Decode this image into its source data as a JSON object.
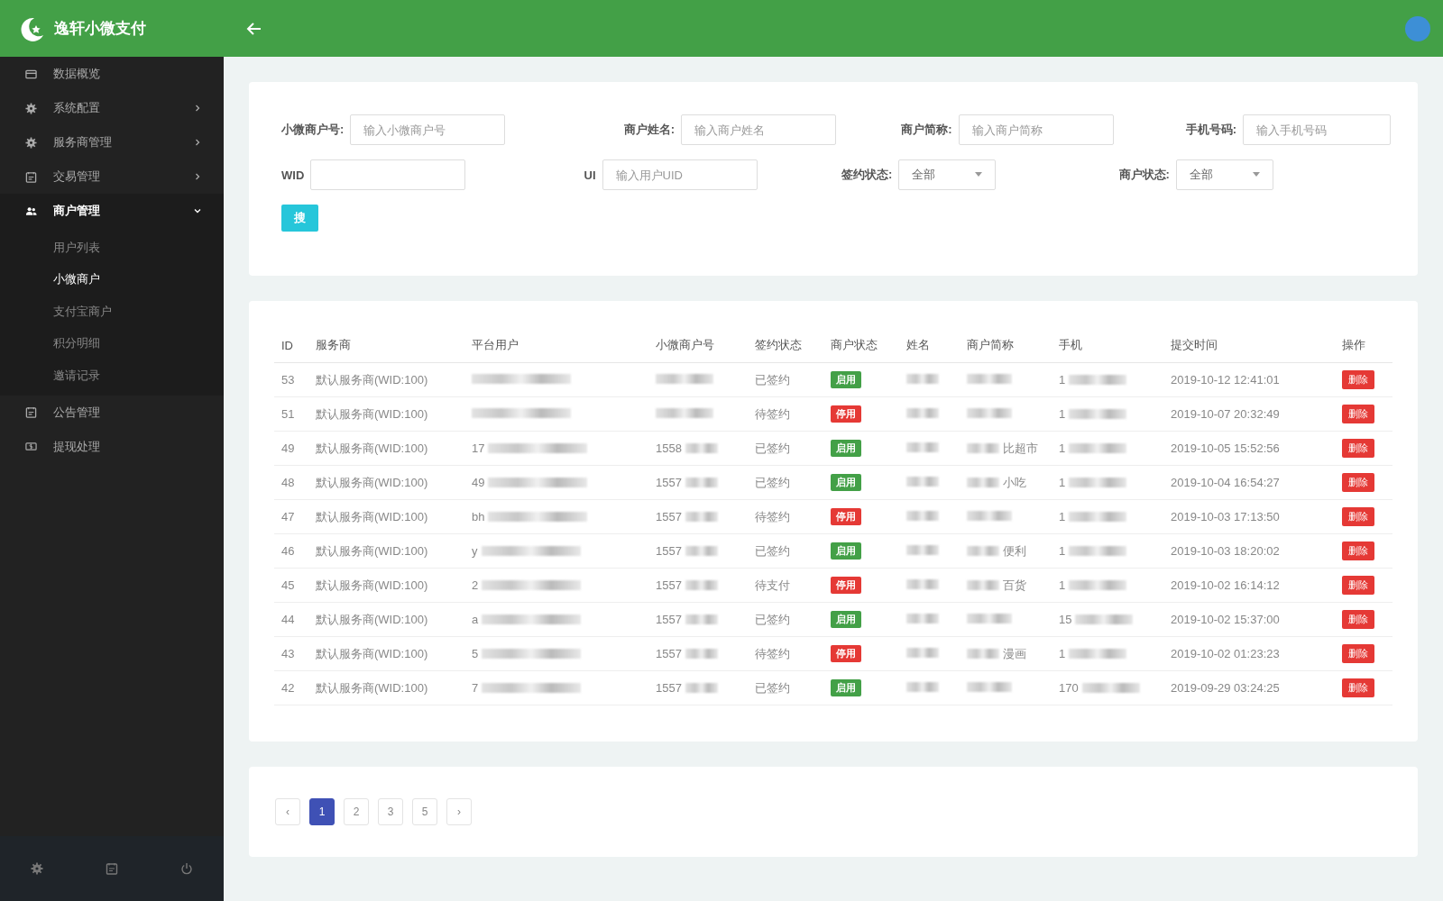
{
  "app": {
    "title": "逸轩小微支付"
  },
  "sidebar": {
    "items": [
      {
        "label": "数据概览",
        "has_children": false,
        "selected": false
      },
      {
        "label": "系统配置",
        "has_children": true,
        "expanded": false,
        "selected": false
      },
      {
        "label": "服务商管理",
        "has_children": true,
        "expanded": false,
        "selected": false
      },
      {
        "label": "交易管理",
        "has_children": true,
        "expanded": false,
        "selected": false
      },
      {
        "label": "商户管理",
        "has_children": true,
        "expanded": true,
        "selected": true,
        "children": [
          {
            "label": "用户列表",
            "selected": false
          },
          {
            "label": "小微商户",
            "selected": true
          },
          {
            "label": "支付宝商户",
            "selected": false
          },
          {
            "label": "积分明细",
            "selected": false
          },
          {
            "label": "邀请记录",
            "selected": false
          }
        ]
      },
      {
        "label": "公告管理",
        "has_children": false,
        "selected": false
      },
      {
        "label": "提现处理",
        "has_children": false,
        "selected": false
      }
    ]
  },
  "filters": [
    {
      "kind": "input",
      "label": "小微商户号:",
      "placeholder": "输入小微商户号"
    },
    {
      "kind": "input",
      "label": "商户姓名:",
      "placeholder": "输入商户姓名"
    },
    {
      "kind": "input",
      "label": "商户简称:",
      "placeholder": "输入商户简称"
    },
    {
      "kind": "input",
      "label": "手机号码:",
      "placeholder": "输入手机号码"
    },
    {
      "kind": "input",
      "label": "WID"
    },
    {
      "kind": "input",
      "label": "UI",
      "placeholder": "输入用户UID"
    },
    {
      "kind": "select",
      "label": "签约状态:",
      "value": "全部"
    },
    {
      "kind": "select",
      "label": "商户状态:",
      "value": "全部"
    }
  ],
  "search_button": "搜",
  "table": {
    "columns": [
      "ID",
      "服务商",
      "平台用户",
      "小微商户号",
      "签约状态",
      "商户状态",
      "姓名",
      "商户简称",
      "手机",
      "提交时间",
      "操作"
    ],
    "rows": [
      {
        "id": "53",
        "provider": "默认服务商(WID:100)",
        "sign_status": "已签约",
        "status": "启用",
        "enabled": true,
        "phone": "1",
        "time": "2019-10-12 12:41:01",
        "action": "删除"
      },
      {
        "id": "51",
        "provider": "默认服务商(WID:100)",
        "sign_status": "待签约",
        "status": "停用",
        "enabled": false,
        "phone": "1",
        "time": "2019-10-07 20:32:49",
        "action": "删除"
      },
      {
        "id": "49",
        "provider": "默认服务商(WID:100)",
        "user": "17",
        "merchant_no": "1558",
        "sign_status": "已签约",
        "status": "启用",
        "enabled": true,
        "short_name": "比超市",
        "phone": "1",
        "time": "2019-10-05 15:52:56",
        "action": "删除"
      },
      {
        "id": "48",
        "provider": "默认服务商(WID:100)",
        "user": "49",
        "merchant_no": "1557",
        "sign_status": "已签约",
        "status": "启用",
        "enabled": true,
        "short_name": "小吃",
        "phone": "1",
        "time": "2019-10-04 16:54:27",
        "action": "删除"
      },
      {
        "id": "47",
        "provider": "默认服务商(WID:100)",
        "user": "bh",
        "merchant_no": "1557",
        "sign_status": "待签约",
        "status": "停用",
        "enabled": false,
        "phone": "1",
        "time": "2019-10-03 17:13:50",
        "action": "删除"
      },
      {
        "id": "46",
        "provider": "默认服务商(WID:100)",
        "user": "y",
        "merchant_no": "1557",
        "sign_status": "已签约",
        "status": "启用",
        "enabled": true,
        "short_name": "便利",
        "phone": "1",
        "time": "2019-10-03 18:20:02",
        "action": "删除"
      },
      {
        "id": "45",
        "provider": "默认服务商(WID:100)",
        "user": "2",
        "merchant_no": "1557",
        "sign_status": "待支付",
        "status": "停用",
        "enabled": false,
        "short_name": "百货",
        "phone": "1",
        "time": "2019-10-02 16:14:12",
        "action": "删除"
      },
      {
        "id": "44",
        "provider": "默认服务商(WID:100)",
        "user": "a",
        "merchant_no": "1557",
        "sign_status": "已签约",
        "status": "启用",
        "enabled": true,
        "phone": "15",
        "time": "2019-10-02 15:37:00",
        "action": "删除"
      },
      {
        "id": "43",
        "provider": "默认服务商(WID:100)",
        "user": "5",
        "merchant_no": "1557",
        "sign_status": "待签约",
        "status": "停用",
        "enabled": false,
        "short_name": "漫画",
        "phone": "1",
        "time": "2019-10-02 01:23:23",
        "action": "删除"
      },
      {
        "id": "42",
        "provider": "默认服务商(WID:100)",
        "user": "7",
        "merchant_no": "1557",
        "sign_status": "已签约",
        "status": "启用",
        "enabled": true,
        "phone": "170",
        "time": "2019-09-29 03:24:25",
        "action": "删除"
      }
    ]
  },
  "pagination": {
    "prev": "‹",
    "next": "›",
    "pages": [
      {
        "label": "1",
        "selected": true
      },
      {
        "label": "2",
        "selected": false
      },
      {
        "label": "3",
        "selected": false
      },
      {
        "label": "5",
        "selected": false
      }
    ]
  }
}
